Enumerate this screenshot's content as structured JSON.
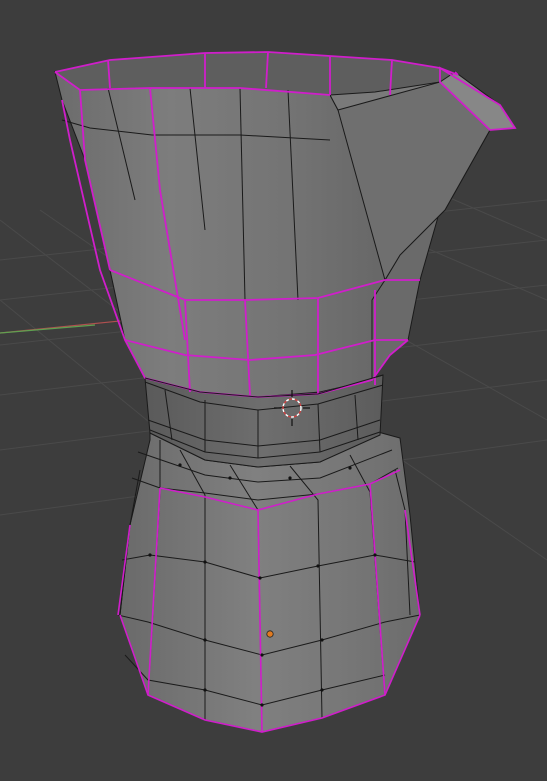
{
  "viewport": {
    "background": "#3d3d3d",
    "grid_color": "#4a4a4a",
    "x_axis_color": "#b05050",
    "y_axis_color": "#5fa050"
  },
  "object": {
    "type": "mesh",
    "mode": "edit",
    "shape": "moka-pot",
    "body_color": "#767676",
    "wire_color": "#1a1a1a",
    "seam_color": "#d01ecb",
    "vertex_color": "#111111"
  },
  "cursor": {
    "type": "3d-cursor",
    "color": "#ffffff",
    "accent": "#d04040"
  },
  "origin": {
    "color": "#e07a20"
  }
}
